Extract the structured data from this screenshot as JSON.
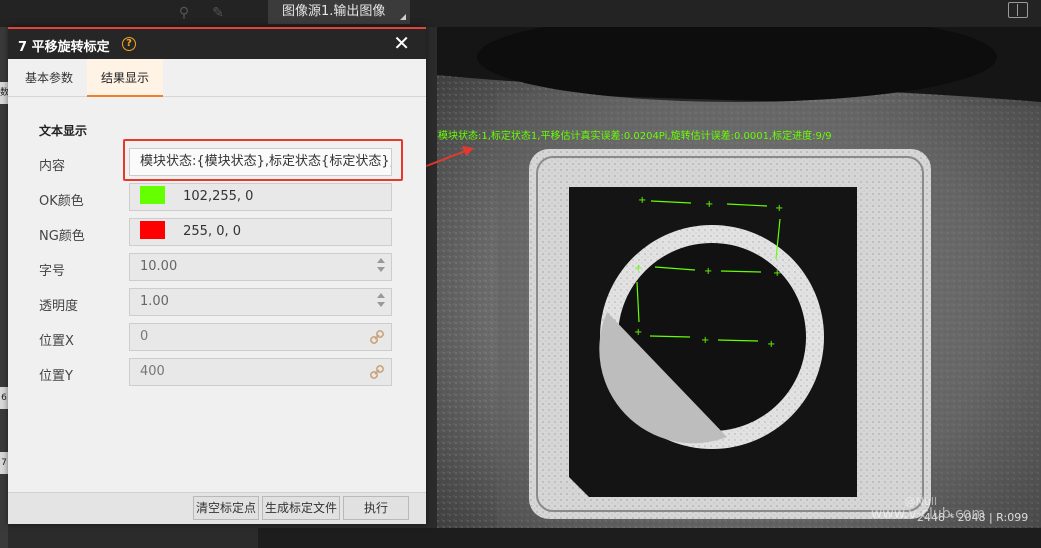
{
  "app": {
    "view_tab": "图像源1.输出图像",
    "left_strip_labels": [
      "数",
      "6",
      "7"
    ]
  },
  "dialog": {
    "title": "7 平移旋转标定",
    "help_icon": "question-icon",
    "close_icon": "close-icon",
    "tabs": [
      {
        "label": "基本参数",
        "active": false
      },
      {
        "label": "结果显示",
        "active": true
      }
    ],
    "section_title": "文本显示",
    "fields": {
      "content": {
        "label": "内容",
        "value": "模块状态:{模块状态},标定状态{标定状态},"
      },
      "ok_color": {
        "label": "OK颜色",
        "value": "102,255,  0",
        "swatch": "#66ff00"
      },
      "ng_color": {
        "label": "NG颜色",
        "value": "255,  0,  0",
        "swatch": "#ff0000"
      },
      "font_size": {
        "label": "字号",
        "value": "10.00"
      },
      "opacity": {
        "label": "透明度",
        "value": "1.00"
      },
      "pos_x": {
        "label": "位置X",
        "value": "0"
      },
      "pos_y": {
        "label": "位置Y",
        "value": "400"
      }
    },
    "buttons": {
      "clear": "清空标定点",
      "generate": "生成标定文件",
      "execute": "执行"
    }
  },
  "viewer": {
    "overlay_text": "模块状态:1,标定状态1,平移估计真实误差:0.0204Pi,旋转估计误差:0.0001,标定进度:9/9",
    "watermark": "www.v-club.com",
    "watermark_user": "@Null",
    "status": "2448 * 2048  |  R:099",
    "accent_green": "#66ff00"
  }
}
